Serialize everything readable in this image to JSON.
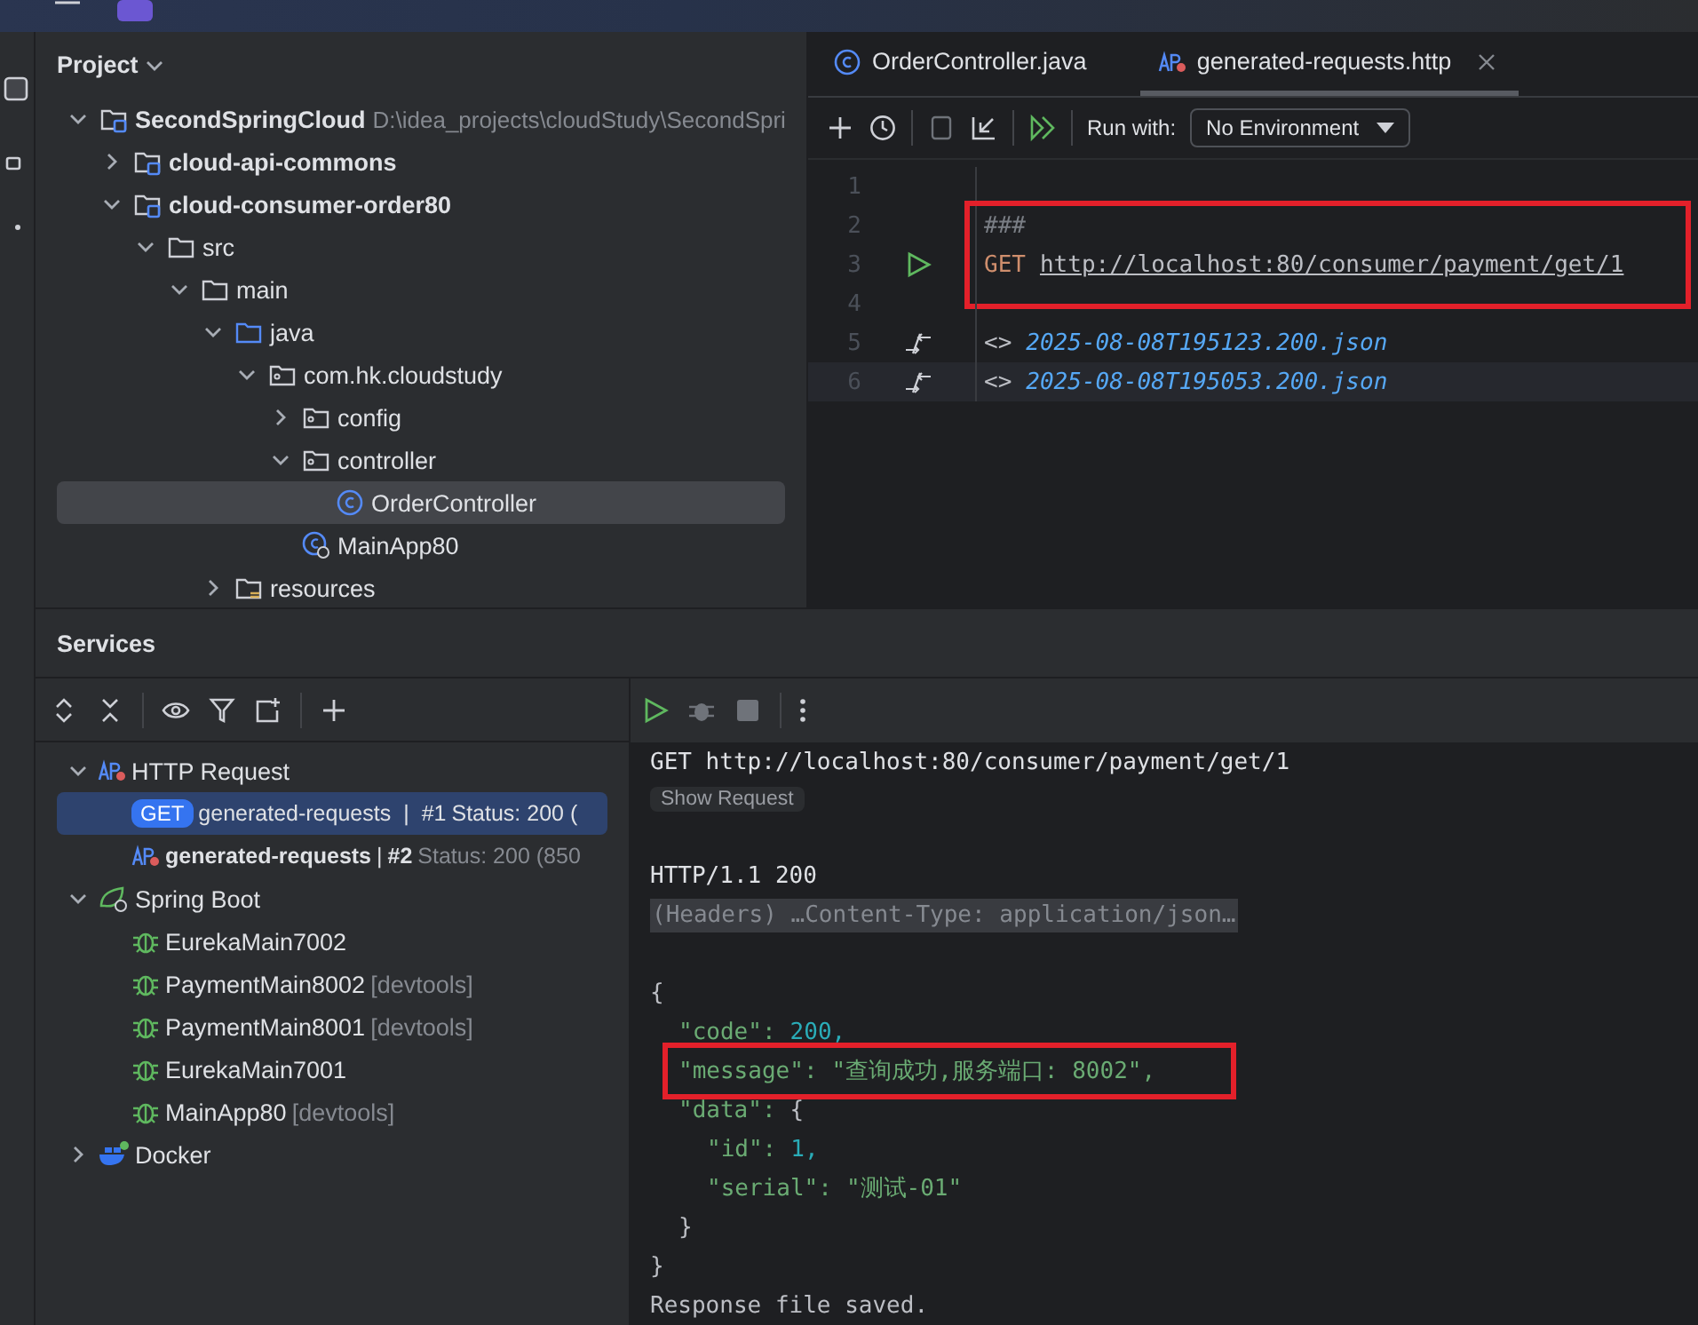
{
  "project": {
    "title": "Project",
    "tree": [
      {
        "label": "SecondSpringCloud",
        "hint": "D:\\idea_projects\\cloudStudy\\SecondSpri",
        "kind": "module",
        "expanded": true,
        "selected": false,
        "children": [
          {
            "label": "cloud-api-commons",
            "kind": "module",
            "expanded": false,
            "selected": false
          },
          {
            "label": "cloud-consumer-order80",
            "kind": "module",
            "expanded": true,
            "selected": false,
            "children": [
              {
                "label": "src",
                "kind": "folder",
                "expanded": true,
                "selected": false,
                "children": [
                  {
                    "label": "main",
                    "kind": "folder",
                    "expanded": true,
                    "selected": false,
                    "children": [
                      {
                        "label": "java",
                        "kind": "source",
                        "expanded": true,
                        "selected": false,
                        "children": [
                          {
                            "label": "com.hk.cloudstudy",
                            "kind": "package",
                            "expanded": true,
                            "selected": false,
                            "children": [
                              {
                                "label": "config",
                                "kind": "package",
                                "expanded": false,
                                "selected": false
                              },
                              {
                                "label": "controller",
                                "kind": "package",
                                "expanded": true,
                                "selected": false,
                                "children": [
                                  {
                                    "label": "OrderController",
                                    "kind": "class",
                                    "selected": true
                                  }
                                ]
                              },
                              {
                                "label": "MainApp80",
                                "kind": "main-class",
                                "selected": false
                              }
                            ]
                          }
                        ]
                      },
                      {
                        "label": "resources",
                        "kind": "resources",
                        "expanded": false,
                        "selected": false
                      }
                    ]
                  }
                ]
              }
            ]
          }
        ]
      }
    ]
  },
  "editor": {
    "tabs": [
      {
        "label": "OrderController.java",
        "kind": "class",
        "selected": false,
        "closable": false
      },
      {
        "label": "generated-requests.http",
        "kind": "http",
        "selected": true,
        "closable": true
      }
    ],
    "toolbar": {
      "run_with_label": "Run with:",
      "environment": "No Environment"
    },
    "lines": [
      {
        "number": "1",
        "kind": "blank",
        "current": false,
        "annotated": false
      },
      {
        "number": "2",
        "kind": "separator",
        "text": "###",
        "current": false,
        "annotated": false
      },
      {
        "number": "3",
        "kind": "request",
        "method": "GET",
        "url": "http://localhost:80/consumer/payment/get/1",
        "current": false,
        "annotated": true
      },
      {
        "number": "4",
        "kind": "blank",
        "current": false,
        "annotated": false
      },
      {
        "number": "5",
        "kind": "response-ref",
        "marker": "<>",
        "file": "2025-08-08T195123.200.json",
        "current": false,
        "annotated": false
      },
      {
        "number": "6",
        "kind": "response-ref",
        "marker": "<>",
        "file": "2025-08-08T195053.200.json",
        "current": true,
        "annotated": false
      }
    ]
  },
  "services": {
    "title": "Services",
    "tree": [
      {
        "label": "HTTP Request",
        "kind": "http-group",
        "expanded": true,
        "selected": false,
        "children": [
          {
            "kind": "request",
            "method": "GET",
            "label": "generated-requests",
            "separator": "|",
            "run": "#1",
            "status": "Status: 200 (",
            "selected": true
          },
          {
            "kind": "request",
            "label": "generated-requests",
            "separator": "|",
            "run": "#2",
            "status": "Status: 200 (850",
            "selected": false
          }
        ]
      },
      {
        "label": "Spring Boot",
        "kind": "spring-group",
        "expanded": true,
        "selected": false,
        "children": [
          {
            "label": "EurekaMain7002",
            "kind": "app",
            "selected": false
          },
          {
            "label": "PaymentMain8002",
            "hint": "[devtools]",
            "kind": "app",
            "selected": false
          },
          {
            "label": "PaymentMain8001",
            "hint": "[devtools]",
            "kind": "app",
            "selected": false
          },
          {
            "label": "EurekaMain7001",
            "kind": "app",
            "selected": false
          },
          {
            "label": "MainApp80",
            "hint": "[devtools]",
            "kind": "app",
            "selected": false
          }
        ]
      },
      {
        "label": "Docker",
        "kind": "docker",
        "expanded": false,
        "selected": false
      }
    ],
    "output": {
      "request_line": "GET http://localhost:80/consumer/payment/get/1",
      "show_request": "Show Request",
      "status_line": "HTTP/1.1 200",
      "headers": "(Headers) …Content-Type: application/json…",
      "body": {
        "open": "{",
        "close": "}",
        "fields": [
          {
            "key": "\"code\":",
            "value": "200,",
            "kind": "number",
            "annotated": false
          },
          {
            "key": "\"message\":",
            "value": "\"查询成功,服务端口: 8002\",",
            "kind": "string",
            "annotated": true
          },
          {
            "key": "\"data\":",
            "kind": "object",
            "annotated": false,
            "object": {
              "open": "{",
              "close": "}",
              "fields": [
                {
                  "key": "\"id\":",
                  "value": "1,",
                  "kind": "number",
                  "annotated": false
                },
                {
                  "key": "\"serial\":",
                  "value": "\"测试-01\"",
                  "kind": "string",
                  "annotated": false
                }
              ]
            }
          }
        ]
      },
      "footer": "Response file saved."
    }
  }
}
